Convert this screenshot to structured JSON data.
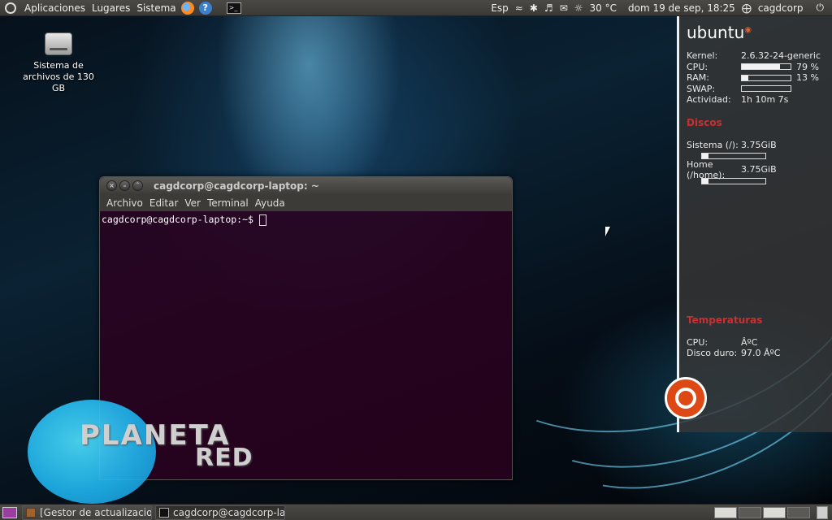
{
  "top_panel": {
    "menu_apps": "Aplicaciones",
    "menu_places": "Lugares",
    "menu_system": "Sistema",
    "terminal_glyph": ">_",
    "help_glyph": "?",
    "keyboard_layout": "Esp",
    "weather_temp": "30 °C",
    "datetime": "dom 19 de sep, 18:25",
    "user": "cagdcorp"
  },
  "desktop": {
    "disk_icon_label_1": "Sistema de",
    "disk_icon_label_2": "archivos de 130 GB"
  },
  "conky": {
    "logo": "ubuntu",
    "kernel_label": "Kernel:",
    "kernel_value": "2.6.32-24-generic",
    "cpu_label": "CPU:",
    "cpu_value": "79 %",
    "cpu_fraction": 0.79,
    "ram_label": "RAM:",
    "ram_value": "13 %",
    "ram_fraction": 0.13,
    "swap_label": "SWAP:",
    "swap_fraction": 0.0,
    "activity_label": "Actividad:",
    "activity_value": "1h 10m 7s",
    "disks_title": "Discos",
    "disk_system_label": "Sistema (/):",
    "disk_system_value": "3.75GiB",
    "disk_system_fraction": 0.1,
    "disk_home_label": "Home (/home):",
    "disk_home_value": "3.75GiB",
    "disk_home_fraction": 0.1,
    "temps_title": "Temperaturas",
    "temp_cpu_label": "CPU:",
    "temp_cpu_value": "ÂºC",
    "temp_disk_label": "Disco duro:",
    "temp_disk_value": "97.0 ÂºC"
  },
  "terminal": {
    "title": "cagdcorp@cagdcorp-laptop: ~",
    "menu": [
      "Archivo",
      "Editar",
      "Ver",
      "Terminal",
      "Ayuda"
    ],
    "prompt": "cagdcorp@cagdcorp-laptop:~$ "
  },
  "watermark": {
    "line1": "PLANETA",
    "line2": "RED"
  },
  "bottom_panel": {
    "task1": "[Gestor de actualizacio...",
    "task2": "cagdcorp@cagdcorp-la..."
  },
  "colors": {
    "conky_section": "#c83030",
    "ubuntu_orange": "#dd4814",
    "terminal_bg": "#2c001e"
  }
}
